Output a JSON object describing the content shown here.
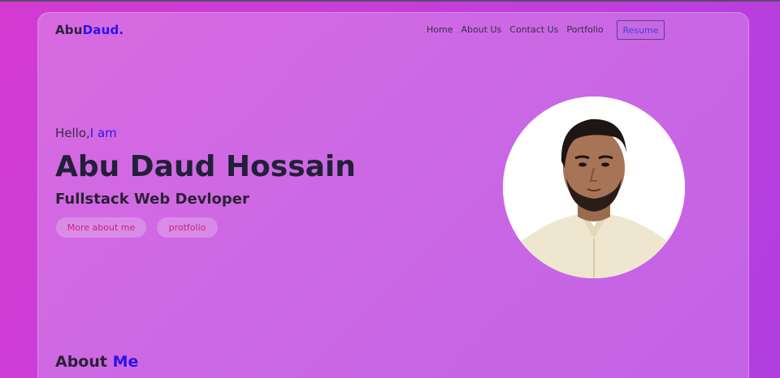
{
  "brand": {
    "first": "Abu",
    "accent": "Daud."
  },
  "nav": {
    "items": [
      "Home",
      "About Us",
      "Contact Us",
      "Portfolio"
    ],
    "resume_label": "Resume"
  },
  "hero": {
    "greeting_prefix": "Hello,",
    "greeting_accent": "I am",
    "name": "Abu Daud Hossain",
    "role": "Fullstack Web Devloper",
    "buttons": {
      "more": "More about me",
      "portfolio": "protfolio"
    },
    "avatar_icon": "profile-photo"
  },
  "about": {
    "prefix": "About ",
    "accent": "Me"
  },
  "colors": {
    "accent": "#2b14e8",
    "background": "#c94cd8",
    "pill_text": "#c02a7c"
  }
}
